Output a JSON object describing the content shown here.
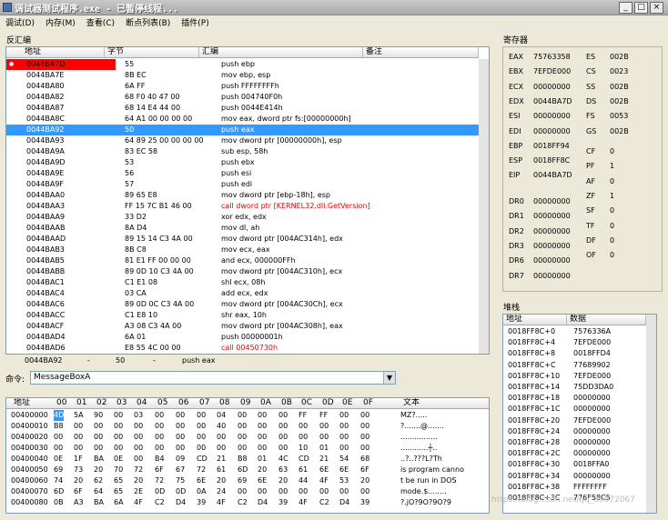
{
  "window": {
    "title": "调试器测试程序.exe - 已暂停线程..."
  },
  "window_buttons": {
    "min": "_",
    "max": "□",
    "close": "×"
  },
  "menu": [
    "调试(D)",
    "内存(M)",
    "查看(C)",
    "断点列表(B)",
    "插件(P)"
  ],
  "disasm": {
    "panel_title": "反汇编",
    "headers": [
      "地址",
      "字节",
      "汇编",
      "备注"
    ],
    "rows": [
      {
        "addr": "0044BA7D",
        "bytes": "55",
        "asm": "push ebp",
        "bp": true
      },
      {
        "addr": "0044BA7E",
        "bytes": "8B EC",
        "asm": "mov ebp, esp"
      },
      {
        "addr": "0044BA80",
        "bytes": "6A FF",
        "asm": "push FFFFFFFFh"
      },
      {
        "addr": "0044BA82",
        "bytes": "68 F0 40 47 00",
        "asm": "push 004740F0h"
      },
      {
        "addr": "0044BA87",
        "bytes": "68 14 E4 44 00",
        "asm": "push 0044E414h"
      },
      {
        "addr": "0044BA8C",
        "bytes": "64 A1 00 00 00 00",
        "asm": "mov eax, dword ptr fs:[00000000h]"
      },
      {
        "addr": "0044BA92",
        "bytes": "50",
        "asm": "push eax",
        "selected": true
      },
      {
        "addr": "0044BA93",
        "bytes": "64 89 25 00 00 00 00",
        "asm": "mov dword ptr [00000000h], esp"
      },
      {
        "addr": "0044BA9A",
        "bytes": "83 EC 58",
        "asm": "sub esp, 58h"
      },
      {
        "addr": "0044BA9D",
        "bytes": "53",
        "asm": "push ebx"
      },
      {
        "addr": "0044BA9E",
        "bytes": "56",
        "asm": "push esi"
      },
      {
        "addr": "0044BA9F",
        "bytes": "57",
        "asm": "push edi"
      },
      {
        "addr": "0044BAA0",
        "bytes": "89 65 E8",
        "asm": "mov dword ptr [ebp-18h], esp"
      },
      {
        "addr": "0044BAA3",
        "bytes": "FF 15 7C B1 46 00",
        "asm": "call dword ptr [KERNEL32.dll.GetVersion]",
        "red": true
      },
      {
        "addr": "0044BAA9",
        "bytes": "33 D2",
        "asm": "xor edx, edx"
      },
      {
        "addr": "0044BAAB",
        "bytes": "8A D4",
        "asm": "mov dl, ah"
      },
      {
        "addr": "0044BAAD",
        "bytes": "89 15 14 C3 4A 00",
        "asm": "mov dword ptr [004AC314h], edx"
      },
      {
        "addr": "0044BAB3",
        "bytes": "8B C8",
        "asm": "mov ecx, eax"
      },
      {
        "addr": "0044BAB5",
        "bytes": "81 E1 FF 00 00 00",
        "asm": "and ecx, 000000FFh"
      },
      {
        "addr": "0044BABB",
        "bytes": "89 0D 10 C3 4A 00",
        "asm": "mov dword ptr [004AC310h], ecx"
      },
      {
        "addr": "0044BAC1",
        "bytes": "C1 E1 08",
        "asm": "shl ecx, 08h"
      },
      {
        "addr": "0044BAC4",
        "bytes": "03 CA",
        "asm": "add ecx, edx"
      },
      {
        "addr": "0044BAC6",
        "bytes": "89 0D 0C C3 4A 00",
        "asm": "mov dword ptr [004AC30Ch], ecx"
      },
      {
        "addr": "0044BACC",
        "bytes": "C1 E8 10",
        "asm": "shr eax, 10h"
      },
      {
        "addr": "0044BACF",
        "bytes": "A3 08 C3 4A 00",
        "asm": "mov dword ptr [004AC308h], eax"
      },
      {
        "addr": "0044BAD4",
        "bytes": "6A 01",
        "asm": "push 00000001h"
      },
      {
        "addr": "0044BAD6",
        "bytes": "E8 55 4C 00 00",
        "asm": "call 00450730h",
        "red": true
      }
    ],
    "status": {
      "addr": "0044BA92",
      "dash1": "-",
      "num": "50",
      "dash2": "-",
      "asm": "push eax"
    }
  },
  "command": {
    "label": "命令:",
    "value": "MessageBoxA"
  },
  "registers": {
    "panel_title": "寄存器",
    "left": [
      {
        "name": "EAX",
        "value": "75763358"
      },
      {
        "name": "EBX",
        "value": "7EFDE000"
      },
      {
        "name": "ECX",
        "value": "00000000"
      },
      {
        "name": "EDX",
        "value": "0044BA7D"
      },
      {
        "name": "ESI",
        "value": "00000000"
      },
      {
        "name": "EDI",
        "value": "00000000"
      },
      {
        "name": "EBP",
        "value": "0018FF94"
      },
      {
        "name": "ESP",
        "value": "0018FF8C"
      },
      {
        "name": "EIP",
        "value": "0044BA7D"
      }
    ],
    "segments": [
      {
        "name": "ES",
        "value": "002B"
      },
      {
        "name": "CS",
        "value": "0023"
      },
      {
        "name": "SS",
        "value": "002B"
      },
      {
        "name": "DS",
        "value": "002B"
      },
      {
        "name": "FS",
        "value": "0053"
      },
      {
        "name": "GS",
        "value": "002B"
      }
    ],
    "flags": [
      {
        "name": "CF",
        "value": "0"
      },
      {
        "name": "PF",
        "value": "1"
      },
      {
        "name": "AF",
        "value": "0"
      },
      {
        "name": "ZF",
        "value": "1"
      },
      {
        "name": "SF",
        "value": "0"
      },
      {
        "name": "TF",
        "value": "0"
      },
      {
        "name": "DF",
        "value": "0"
      },
      {
        "name": "OF",
        "value": "0"
      }
    ],
    "debug": [
      {
        "name": "DR0",
        "value": "00000000"
      },
      {
        "name": "DR1",
        "value": "00000000"
      },
      {
        "name": "DR2",
        "value": "00000000"
      },
      {
        "name": "DR3",
        "value": "00000000"
      },
      {
        "name": "DR6",
        "value": "00000000"
      },
      {
        "name": "DR7",
        "value": "00000000"
      }
    ]
  },
  "stack": {
    "panel_title": "堆栈",
    "headers": [
      "地址",
      "数据"
    ],
    "rows": [
      {
        "addr": "0018FF8C+0",
        "data": "7576336A"
      },
      {
        "addr": "0018FF8C+4",
        "data": "7EFDE000"
      },
      {
        "addr": "0018FF8C+8",
        "data": "0018FFD4"
      },
      {
        "addr": "0018FF8C+C",
        "data": "77689902"
      },
      {
        "addr": "0018FF8C+10",
        "data": "7EFDE000"
      },
      {
        "addr": "0018FF8C+14",
        "data": "75DD3DA0"
      },
      {
        "addr": "0018FF8C+18",
        "data": "00000000"
      },
      {
        "addr": "0018FF8C+1C",
        "data": "00000000"
      },
      {
        "addr": "0018FF8C+20",
        "data": "7EFDE000"
      },
      {
        "addr": "0018FF8C+24",
        "data": "00000000"
      },
      {
        "addr": "0018FF8C+28",
        "data": "00000000"
      },
      {
        "addr": "0018FF8C+2C",
        "data": "00000000"
      },
      {
        "addr": "0018FF8C+30",
        "data": "0018FFA0"
      },
      {
        "addr": "0018FF8C+34",
        "data": "00000000"
      },
      {
        "addr": "0018FF8C+38",
        "data": "FFFFFFFF"
      },
      {
        "addr": "0018FF8C+3C",
        "data": "776F58C5"
      }
    ]
  },
  "hexdump": {
    "headers": [
      "地址",
      "00",
      "01",
      "02",
      "03",
      "04",
      "05",
      "06",
      "07",
      "08",
      "09",
      "0A",
      "0B",
      "0C",
      "0D",
      "0E",
      "0F",
      "文本"
    ],
    "rows": [
      {
        "addr": "00400000",
        "bytes": [
          "4D",
          "5A",
          "90",
          "00",
          "03",
          "00",
          "00",
          "00",
          "04",
          "00",
          "00",
          "00",
          "FF",
          "FF",
          "00",
          "00"
        ],
        "text": "MZ?.....",
        "hl": 0
      },
      {
        "addr": "00400010",
        "bytes": [
          "B8",
          "00",
          "00",
          "00",
          "00",
          "00",
          "00",
          "00",
          "40",
          "00",
          "00",
          "00",
          "00",
          "00",
          "00",
          "00"
        ],
        "text": "?.......@......."
      },
      {
        "addr": "00400020",
        "bytes": [
          "00",
          "00",
          "00",
          "00",
          "00",
          "00",
          "00",
          "00",
          "00",
          "00",
          "00",
          "00",
          "00",
          "00",
          "00",
          "00"
        ],
        "text": "................"
      },
      {
        "addr": "00400030",
        "bytes": [
          "00",
          "00",
          "00",
          "00",
          "00",
          "00",
          "00",
          "00",
          "00",
          "00",
          "00",
          "00",
          "10",
          "01",
          "00",
          "00"
        ],
        "text": "............┼.."
      },
      {
        "addr": "00400040",
        "bytes": [
          "0E",
          "1F",
          "BA",
          "0E",
          "00",
          "B4",
          "09",
          "CD",
          "21",
          "B8",
          "01",
          "4C",
          "CD",
          "21",
          "54",
          "68"
        ],
        "text": "..?..???L?Th"
      },
      {
        "addr": "00400050",
        "bytes": [
          "69",
          "73",
          "20",
          "70",
          "72",
          "6F",
          "67",
          "72",
          "61",
          "6D",
          "20",
          "63",
          "61",
          "6E",
          "6E",
          "6F"
        ],
        "text": "is program canno"
      },
      {
        "addr": "00400060",
        "bytes": [
          "74",
          "20",
          "62",
          "65",
          "20",
          "72",
          "75",
          "6E",
          "20",
          "69",
          "6E",
          "20",
          "44",
          "4F",
          "53",
          "20"
        ],
        "text": "t be run in DOS "
      },
      {
        "addr": "00400070",
        "bytes": [
          "6D",
          "6F",
          "64",
          "65",
          "2E",
          "0D",
          "0D",
          "0A",
          "24",
          "00",
          "00",
          "00",
          "00",
          "00",
          "00",
          "00"
        ],
        "text": "mode.$........"
      },
      {
        "addr": "00400080",
        "bytes": [
          "0B",
          "A3",
          "BA",
          "6A",
          "4F",
          "C2",
          "D4",
          "39",
          "4F",
          "C2",
          "D4",
          "39",
          "4F",
          "C2",
          "D4",
          "39"
        ],
        "text": "?.jO?9O?9O?9"
      }
    ]
  },
  "watermark": "https://blog.csdn.net/qq_39672067"
}
